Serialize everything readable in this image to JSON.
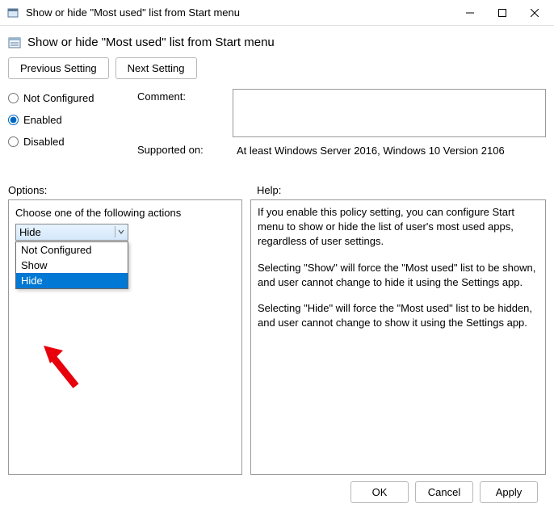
{
  "window": {
    "title": "Show or hide \"Most used\" list from Start menu"
  },
  "heading": "Show or hide \"Most used\" list from Start menu",
  "nav": {
    "previous": "Previous Setting",
    "next": "Next Setting"
  },
  "radios": {
    "not_configured": "Not Configured",
    "enabled": "Enabled",
    "disabled": "Disabled",
    "selected": "Enabled"
  },
  "labels": {
    "comment": "Comment:",
    "supported": "Supported on:",
    "options": "Options:",
    "help": "Help:"
  },
  "comment_value": "",
  "supported_value": "At least Windows Server 2016, Windows 10 Version 2106",
  "options": {
    "prompt": "Choose one of the following actions",
    "selected": "Hide",
    "items": [
      "Not Configured",
      "Show",
      "Hide"
    ]
  },
  "help": {
    "p1": "If you enable this policy setting, you can configure Start menu to show or hide the list of user's most used apps, regardless of user settings.",
    "p2": "Selecting \"Show\" will force the \"Most used\" list to be shown, and user cannot change to hide it using the Settings app.",
    "p3": "Selecting \"Hide\" will force the \"Most used\" list to be hidden, and user cannot change to show it using the Settings app."
  },
  "footer": {
    "ok": "OK",
    "cancel": "Cancel",
    "apply": "Apply"
  }
}
